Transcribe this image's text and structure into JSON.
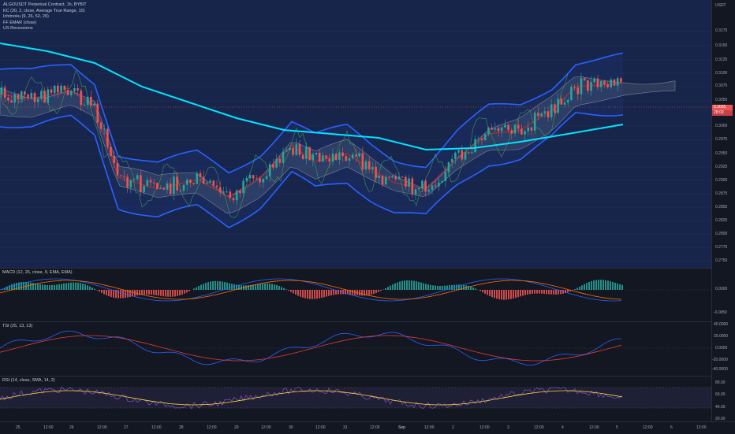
{
  "legend": {
    "title": "ALGOUSDT Perpetual Contract, 1h, BYBIT",
    "indicators": [
      "KC (20, 2, close, Average True Range, 10)",
      "Ichimoku (9, 26, 52, 26)",
      "FF EMAR (close)",
      "US Recessions"
    ]
  },
  "price_axis": {
    "currency": "USDT",
    "ticks": [
      "0.3175",
      "0.3150",
      "0.3125",
      "0.3100",
      "0.3075",
      "0.3050",
      "0.3000",
      "0.2975",
      "0.2950",
      "0.2925",
      "0.2900",
      "0.2875",
      "0.2850",
      "0.2825",
      "0.2800",
      "0.2775",
      "0.2750"
    ],
    "last_price": "0.3035",
    "countdown": "28:00"
  },
  "macd": {
    "label": "MACD (12, 26, close, 9, EMA, EMA)",
    "ticks": [
      "0.0000",
      "-0.0050"
    ]
  },
  "tsi": {
    "label": "TSI (25, 13, 13)",
    "ticks": [
      "40.0000",
      "20.0000",
      "0.0000",
      "-20.0000",
      "-40.0000"
    ]
  },
  "rsi": {
    "label": "RSI (14, close, SMA, 14, 2)",
    "ticks": [
      "80.00",
      "60.00",
      "40.00",
      "20.00"
    ]
  },
  "time_axis": [
    "25",
    "12:00",
    "26",
    "12:00",
    "27",
    "12:00",
    "28",
    "12:00",
    "29",
    "12:00",
    "30",
    "12:00",
    "31",
    "12:00",
    "Sep",
    "12:00",
    "2",
    "12:00",
    "3",
    "12:00",
    "4",
    "12:00",
    "5",
    "12:00",
    "6",
    "12:00"
  ],
  "colors": {
    "bull": "#26a69a",
    "bear": "#ef5350",
    "keltner": "#2962ff",
    "ema": "#00e5ff",
    "background": "#18254b"
  }
}
